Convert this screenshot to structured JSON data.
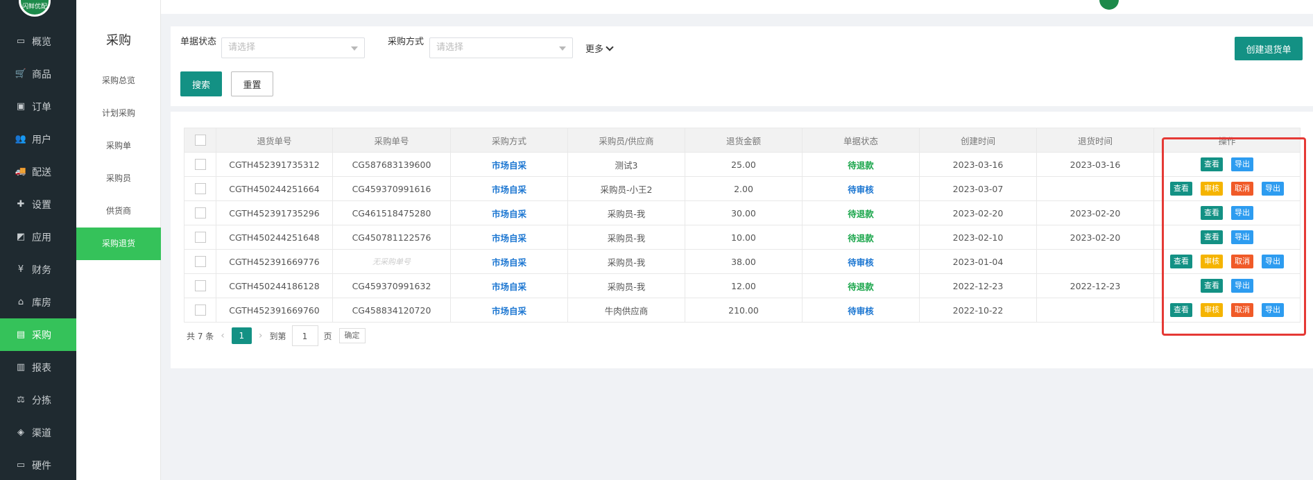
{
  "nav": {
    "logo_text": "闪鲜优配",
    "items": [
      {
        "label": "概览",
        "icon": "monitor-icon"
      },
      {
        "label": "商品",
        "icon": "cart-icon"
      },
      {
        "label": "订单",
        "icon": "order-icon"
      },
      {
        "label": "用户",
        "icon": "users-icon"
      },
      {
        "label": "配送",
        "icon": "truck-icon"
      },
      {
        "label": "设置",
        "icon": "settings-icon"
      },
      {
        "label": "应用",
        "icon": "apps-icon"
      },
      {
        "label": "财务",
        "icon": "yen-icon"
      },
      {
        "label": "库房",
        "icon": "warehouse-icon"
      },
      {
        "label": "采购",
        "icon": "bus-icon"
      },
      {
        "label": "报表",
        "icon": "chart-icon"
      },
      {
        "label": "分拣",
        "icon": "scale-icon"
      },
      {
        "label": "渠道",
        "icon": "box-icon"
      },
      {
        "label": "硬件",
        "icon": "hardware-icon"
      }
    ],
    "active_index": 9
  },
  "submenu": {
    "title": "采购",
    "items": [
      "采购总览",
      "计划采购",
      "采购单",
      "采购员",
      "供货商",
      "采购退货"
    ],
    "active_index": 5
  },
  "filter": {
    "status_label": "单据状态",
    "status_placeholder": "请选择",
    "method_label": "采购方式",
    "method_placeholder": "请选择",
    "more_label": "更多",
    "create_button": "创建退货单",
    "search_button": "搜索",
    "reset_button": "重置"
  },
  "table": {
    "headers": [
      "退货单号",
      "采购单号",
      "采购方式",
      "采购员/供应商",
      "退货金额",
      "单据状态",
      "创建时间",
      "退货时间",
      "操作"
    ],
    "rows": [
      {
        "return_no": "CGTH452391735312",
        "po_no": "CG587683139600",
        "method": "市场自采",
        "buyer": "测试3",
        "amount": "25.00",
        "status": "待退款",
        "created": "2023-03-16",
        "returned": "2023-03-16",
        "ops": [
          "查看",
          "导出"
        ]
      },
      {
        "return_no": "CGTH450244251664",
        "po_no": "CG459370991616",
        "method": "市场自采",
        "buyer": "采购员-小王2",
        "amount": "2.00",
        "status": "待审核",
        "created": "2023-03-07",
        "returned": "",
        "ops": [
          "查看",
          "审核",
          "取消",
          "导出"
        ]
      },
      {
        "return_no": "CGTH452391735296",
        "po_no": "CG461518475280",
        "method": "市场自采",
        "buyer": "采购员-我",
        "amount": "30.00",
        "status": "待退款",
        "created": "2023-02-20",
        "returned": "2023-02-20",
        "ops": [
          "查看",
          "导出"
        ]
      },
      {
        "return_no": "CGTH450244251648",
        "po_no": "CG450781122576",
        "method": "市场自采",
        "buyer": "采购员-我",
        "amount": "10.00",
        "status": "待退款",
        "created": "2023-02-10",
        "returned": "2023-02-20",
        "ops": [
          "查看",
          "导出"
        ]
      },
      {
        "return_no": "CGTH452391669776",
        "po_no": "无采购单号",
        "method": "市场自采",
        "buyer": "采购员-我",
        "amount": "38.00",
        "status": "待审核",
        "created": "2023-01-04",
        "returned": "",
        "ops": [
          "查看",
          "审核",
          "取消",
          "导出"
        ]
      },
      {
        "return_no": "CGTH450244186128",
        "po_no": "CG459370991632",
        "method": "市场自采",
        "buyer": "采购员-我",
        "amount": "12.00",
        "status": "待退款",
        "created": "2022-12-23",
        "returned": "2022-12-23",
        "ops": [
          "查看",
          "导出"
        ]
      },
      {
        "return_no": "CGTH452391669760",
        "po_no": "CG458834120720",
        "method": "市场自采",
        "buyer": "牛肉供应商",
        "amount": "210.00",
        "status": "待审核",
        "created": "2022-10-22",
        "returned": "",
        "ops": [
          "查看",
          "审核",
          "取消",
          "导出"
        ]
      }
    ]
  },
  "pagination": {
    "total": "共 7 条",
    "current": "1",
    "goto_label": "到第",
    "page_input": "1",
    "page_unit": "页",
    "confirm": "确定"
  },
  "colors": {
    "primary": "#139184",
    "active_green": "#35c25a",
    "nav_bg": "#1f2a30",
    "highlight_red": "#e53935"
  }
}
